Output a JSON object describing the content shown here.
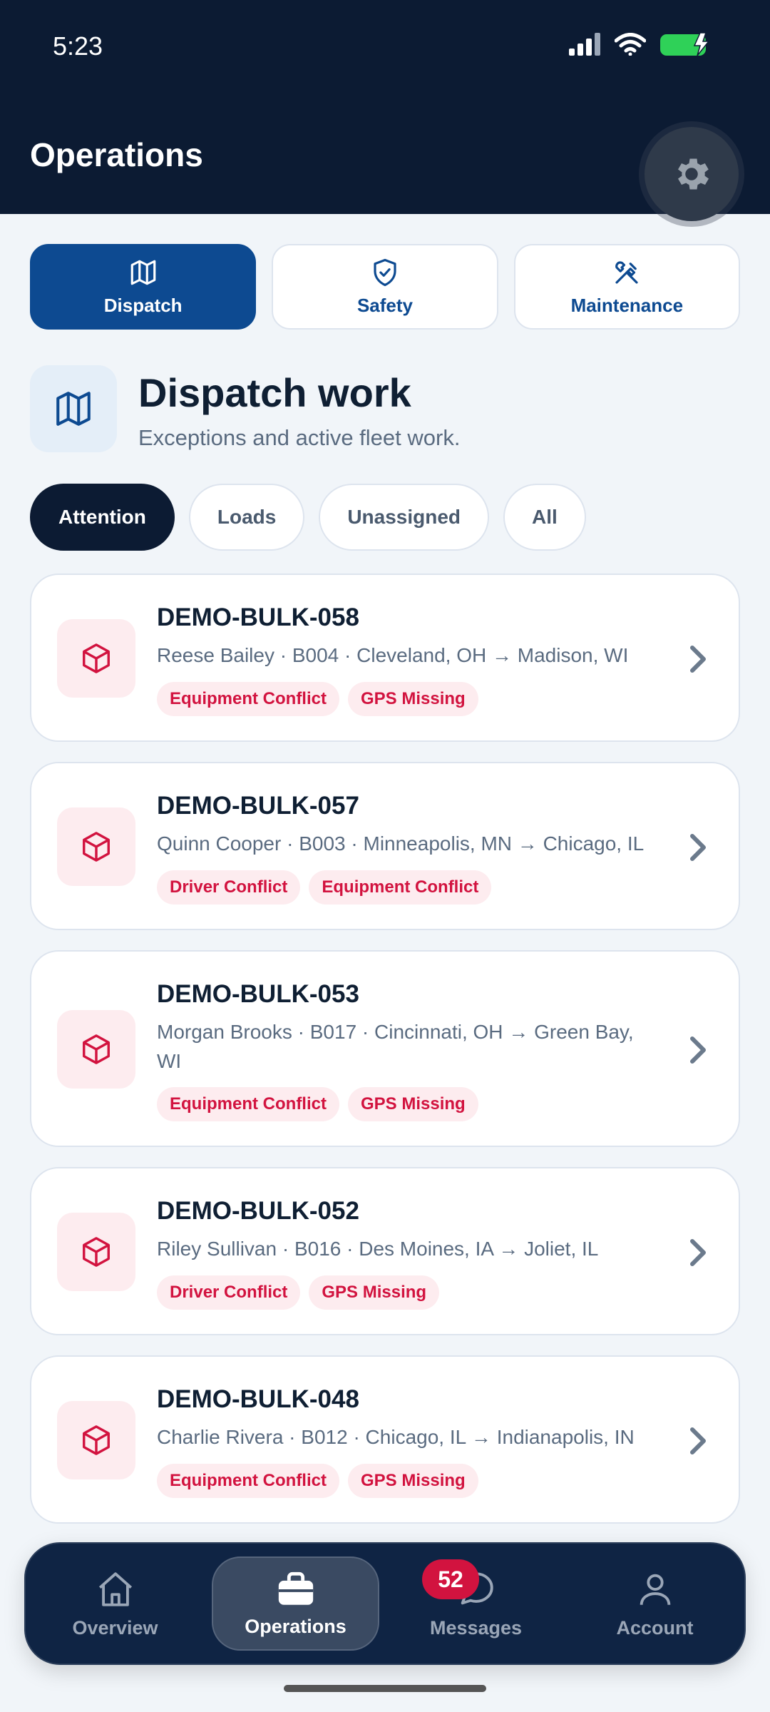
{
  "status_bar": {
    "time": "5:23"
  },
  "header": {
    "title": "Operations"
  },
  "segments": [
    {
      "label": "Dispatch",
      "icon": "map-icon"
    },
    {
      "label": "Safety",
      "icon": "shield-check-icon"
    },
    {
      "label": "Maintenance",
      "icon": "tools-icon"
    }
  ],
  "section": {
    "title": "Dispatch work",
    "subtitle": "Exceptions and active fleet work."
  },
  "filters": [
    "Attention",
    "Loads",
    "Unassigned",
    "All"
  ],
  "loads": [
    {
      "id": "DEMO-BULK-058",
      "meta": "Reese Bailey · B004 · Cleveland, OH → Madison, WI",
      "tags": [
        "Equipment Conflict",
        "GPS Missing"
      ]
    },
    {
      "id": "DEMO-BULK-057",
      "meta": "Quinn Cooper · B003 · Minneapolis, MN → Chicago, IL",
      "tags": [
        "Driver Conflict",
        "Equipment Conflict"
      ]
    },
    {
      "id": "DEMO-BULK-053",
      "meta": "Morgan Brooks · B017 · Cincinnati, OH → Green Bay, WI",
      "tags": [
        "Equipment Conflict",
        "GPS Missing"
      ]
    },
    {
      "id": "DEMO-BULK-052",
      "meta": "Riley Sullivan · B016 · Des Moines, IA → Joliet, IL",
      "tags": [
        "Driver Conflict",
        "GPS Missing"
      ]
    },
    {
      "id": "DEMO-BULK-048",
      "meta": "Charlie Rivera · B012 · Chicago, IL → Indianapolis, IN",
      "tags": [
        "Equipment Conflict",
        "GPS Missing"
      ]
    }
  ],
  "tabbar": {
    "overview": "Overview",
    "operations": "Operations",
    "messages": "Messages",
    "messages_badge": "52",
    "account": "Account"
  },
  "colors": {
    "header_bg": "#0c1b33",
    "accent": "#0d4a91",
    "alert": "#d2133f"
  }
}
